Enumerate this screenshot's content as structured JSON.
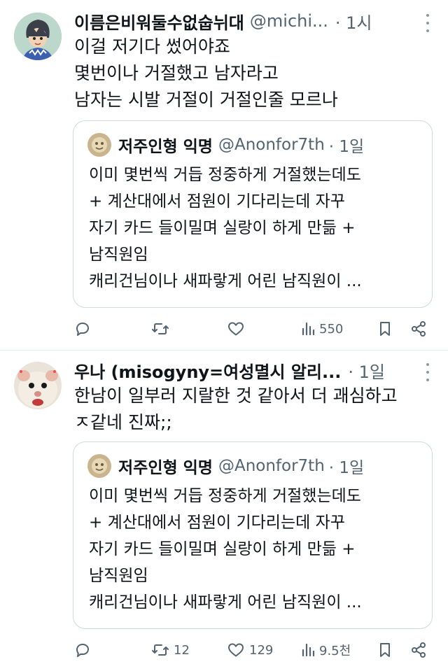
{
  "tweets": [
    {
      "author_name": "이름은비워둘수없숩뉘대",
      "handle": "@michi...",
      "time": "· 1시",
      "lines": [
        "이걸 저기다 썼어야죠",
        "몇번이나 거절했고 남자라고",
        "남자는 시발 거절이 거절인줄 모르나"
      ],
      "quote": {
        "author_name": "저주인형 익명",
        "handle": "@Anonfor7th",
        "time": "· 1일",
        "lines": [
          "이미 몇번씩 거듭 정중하게 거절했는데도",
          "+ 계산대에서 점원이 기다리는데 자꾸",
          "자기 카드 들이밀며 실랑이 하게 만듦 +",
          "남직원임",
          "캐리건님이나 새파랗게 어린 남직원이 ..."
        ]
      },
      "counts": {
        "reply": "",
        "retweet": "",
        "like": "",
        "views": "550"
      }
    },
    {
      "author_name": "우나 (misogyny=여성멸시 알리...",
      "handle": "",
      "time": "· 1일",
      "lines": [
        "한남이 일부러 지랄한 것 같아서 더 괘심하고",
        "ㅈ같네 진짜;;"
      ],
      "quote": {
        "author_name": "저주인형 익명",
        "handle": "@Anonfor7th",
        "time": "· 1일",
        "lines": [
          "이미 몇번씩 거듭 정중하게 거절했는데도",
          "+ 계산대에서 점원이 기다리는데 자꾸",
          "자기 카드 들이밀며 실랑이 하게 만듦 +",
          "남직원임",
          "캐리건님이나 새파랗게 어린 남직원이 ..."
        ]
      },
      "counts": {
        "reply": "",
        "retweet": "12",
        "like": "129",
        "views": "9.5천"
      }
    }
  ],
  "icons": {
    "reply": "reply-icon",
    "retweet": "retweet-icon",
    "like": "heart-icon",
    "views": "views-icon",
    "bookmark": "bookmark-icon",
    "share": "share-icon",
    "more": "more-options-icon"
  },
  "colors": {
    "text": "#0f1419",
    "secondary": "#536471",
    "border": "#cfd9de",
    "divider": "#e6ecf0"
  }
}
